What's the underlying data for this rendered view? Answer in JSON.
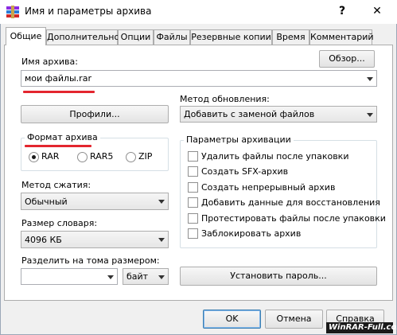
{
  "window": {
    "title": "Имя и параметры архива",
    "help_glyph": "?",
    "close_glyph": "✕"
  },
  "tabs": [
    "Общие",
    "Дополнительно",
    "Опции",
    "Файлы",
    "Резервные копии",
    "Время",
    "Комментарий"
  ],
  "archive_name": {
    "label": "Имя архива:",
    "value": "мои файлы.rar",
    "browse_label": "Обзор..."
  },
  "profiles_label": "Профили...",
  "update_method": {
    "label": "Метод обновления:",
    "value": "Добавить с заменой файлов"
  },
  "archive_format": {
    "title": "Формат архива",
    "options": [
      "RAR",
      "RAR5",
      "ZIP"
    ],
    "selected": "RAR"
  },
  "compression": {
    "label": "Метод сжатия:",
    "value": "Обычный"
  },
  "dictionary": {
    "label": "Размер словаря:",
    "value": "4096 КБ"
  },
  "split": {
    "label": "Разделить на тома размером:",
    "value": "",
    "unit": "байт"
  },
  "archive_options": {
    "title": "Параметры архивации",
    "items": [
      "Удалить файлы после упаковки",
      "Создать SFX-архив",
      "Создать непрерывный архив",
      "Добавить данные для восстановления",
      "Протестировать файлы после упаковки",
      "Заблокировать архив"
    ]
  },
  "set_password_label": "Установить пароль...",
  "footer": {
    "ok": "OK",
    "cancel": "Отмена",
    "help": "Справка"
  },
  "watermark": "WinRAR-Full.com",
  "colors": {
    "annotation_red": "#e3262f",
    "frame_border": "#9aa7b7"
  }
}
